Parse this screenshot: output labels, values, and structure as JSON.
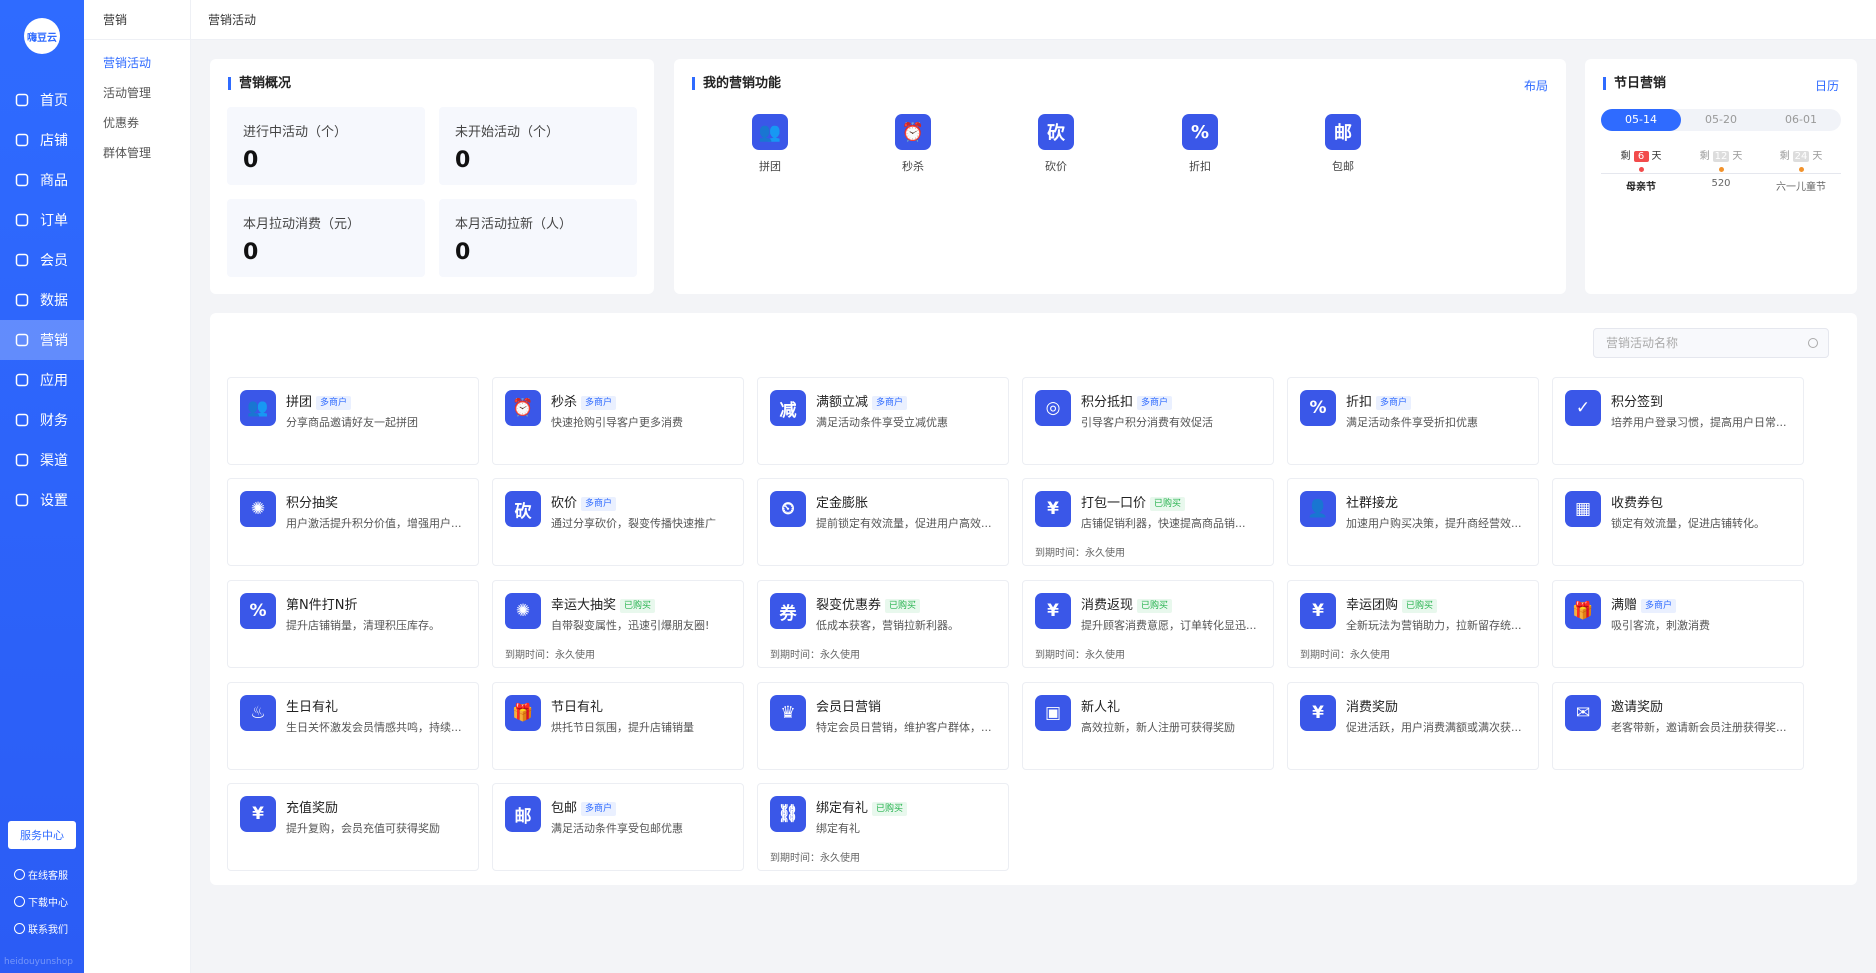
{
  "app": {
    "logo_text": "嗨豆云",
    "watermark": "heidouyunshop"
  },
  "nav": [
    {
      "label": "首页",
      "icon": "home-icon",
      "active": false
    },
    {
      "label": "店铺",
      "icon": "store-icon",
      "active": false
    },
    {
      "label": "商品",
      "icon": "goods-icon",
      "active": false
    },
    {
      "label": "订单",
      "icon": "order-icon",
      "active": false
    },
    {
      "label": "会员",
      "icon": "member-icon",
      "active": false
    },
    {
      "label": "数据",
      "icon": "chart-icon",
      "active": false
    },
    {
      "label": "营销",
      "icon": "tag-icon",
      "active": true
    },
    {
      "label": "应用",
      "icon": "app-icon",
      "active": false
    },
    {
      "label": "财务",
      "icon": "finance-icon",
      "active": false
    },
    {
      "label": "渠道",
      "icon": "channel-icon",
      "active": false
    },
    {
      "label": "设置",
      "icon": "gear-icon",
      "active": false
    }
  ],
  "bottom": {
    "service_center": "服务中心",
    "online_service": "在线客服",
    "download_center": "下载中心",
    "contact_us": "联系我们"
  },
  "subnav": {
    "title": "营销",
    "items": [
      {
        "label": "营销活动",
        "active": true
      },
      {
        "label": "活动管理",
        "active": false
      },
      {
        "label": "优惠券",
        "active": false
      },
      {
        "label": "群体管理",
        "active": false
      }
    ]
  },
  "breadcrumb": "营销活动",
  "overview": {
    "title": "营销概况",
    "stats": [
      {
        "label": "进行中活动（个）",
        "value": "0"
      },
      {
        "label": "未开始活动（个）",
        "value": "0"
      },
      {
        "label": "本月拉动消费（元）",
        "value": "0"
      },
      {
        "label": "本月活动拉新（人）",
        "value": "0"
      }
    ]
  },
  "my_functions": {
    "title": "我的营销功能",
    "layout_link": "布局",
    "items": [
      {
        "label": "拼团",
        "icon": "group-buy-icon",
        "glyph": "👥"
      },
      {
        "label": "秒杀",
        "icon": "alarm-clock-icon",
        "glyph": "⏰"
      },
      {
        "label": "砍价",
        "icon": "bargain-icon",
        "glyph": "砍"
      },
      {
        "label": "折扣",
        "icon": "discount-tag-icon",
        "glyph": "%"
      },
      {
        "label": "包邮",
        "icon": "free-shipping-icon",
        "glyph": "邮"
      }
    ]
  },
  "holiday": {
    "title": "节日营销",
    "calendar_link": "日历",
    "tabs": [
      "05-14",
      "05-20",
      "06-01"
    ],
    "active_tab": 0,
    "days": [
      {
        "prefix": "剩",
        "num": "6",
        "suffix": "天"
      },
      {
        "prefix": "剩",
        "num": "12",
        "suffix": "天"
      },
      {
        "prefix": "剩",
        "num": "24",
        "suffix": "天"
      }
    ],
    "holidays": [
      "母亲节",
      "520",
      "六一儿童节"
    ]
  },
  "search": {
    "placeholder": "营销活动名称"
  },
  "expiry_label": "到期时间：",
  "expiry_value": "永久使用",
  "activities": [
    {
      "name": "拼团",
      "tag": "多商户",
      "tag_type": "multi",
      "desc": "分享商品邀请好友一起拼团",
      "icon": "group-buy-icon",
      "glyph": "👥",
      "expiry": false
    },
    {
      "name": "秒杀",
      "tag": "多商户",
      "tag_type": "multi",
      "desc": "快速抢购引导客户更多消费",
      "icon": "alarm-clock-icon",
      "glyph": "⏰",
      "expiry": false
    },
    {
      "name": "满额立减",
      "tag": "多商户",
      "tag_type": "multi",
      "desc": "满足活动条件享受立减优惠",
      "icon": "reduce-icon",
      "glyph": "减",
      "expiry": false
    },
    {
      "name": "积分抵扣",
      "tag": "多商户",
      "tag_type": "multi",
      "desc": "引导客户积分消费有效促活",
      "icon": "coins-icon",
      "glyph": "◎",
      "expiry": false
    },
    {
      "name": "折扣",
      "tag": "多商户",
      "tag_type": "multi",
      "desc": "满足活动条件享受折扣优惠",
      "icon": "discount-tag-icon",
      "glyph": "%",
      "expiry": false
    },
    {
      "name": "积分签到",
      "tag": "",
      "tag_type": "",
      "desc": "培养用户登录习惯，提高用户日常...",
      "icon": "calendar-check-icon",
      "glyph": "✓",
      "expiry": false
    },
    {
      "name": "积分抽奖",
      "tag": "",
      "tag_type": "",
      "desc": "用户激活提升积分价值，增强用户...",
      "icon": "lottery-wheel-icon",
      "glyph": "✺",
      "expiry": false
    },
    {
      "name": "砍价",
      "tag": "多商户",
      "tag_type": "multi",
      "desc": "通过分享砍价，裂变传播快速推广",
      "icon": "bargain-icon",
      "glyph": "砍",
      "expiry": false
    },
    {
      "name": "定金膨胀",
      "tag": "",
      "tag_type": "",
      "desc": "提前锁定有效流量，促进用户高效...",
      "icon": "deposit-icon",
      "glyph": "⏲",
      "expiry": false
    },
    {
      "name": "打包一口价",
      "tag": "已购买",
      "tag_type": "bought",
      "desc": "店铺促销利器，快速提高商品销...",
      "icon": "package-price-icon",
      "glyph": "¥",
      "expiry": true
    },
    {
      "name": "社群接龙",
      "tag": "",
      "tag_type": "",
      "desc": "加速用户购买决策，提升商经营效...",
      "icon": "community-icon",
      "glyph": "👤",
      "expiry": false
    },
    {
      "name": "收费券包",
      "tag": "",
      "tag_type": "",
      "desc": "锁定有效流量，促进店铺转化。",
      "icon": "coupon-pack-icon",
      "glyph": "▦",
      "expiry": false
    },
    {
      "name": "第N件打N折",
      "tag": "",
      "tag_type": "",
      "desc": "提升店铺销量，清理积压库存。",
      "icon": "nth-discount-icon",
      "glyph": "%",
      "expiry": false
    },
    {
      "name": "幸运大抽奖",
      "tag": "已购买",
      "tag_type": "bought",
      "desc": "自带裂变属性，迅速引爆朋友圈!",
      "icon": "lucky-draw-icon",
      "glyph": "✺",
      "expiry": true
    },
    {
      "name": "裂变优惠券",
      "tag": "已购买",
      "tag_type": "bought",
      "desc": "低成本获客，营销拉新利器。",
      "icon": "fission-coupon-icon",
      "glyph": "券",
      "expiry": true
    },
    {
      "name": "消费返现",
      "tag": "已购买",
      "tag_type": "bought",
      "desc": "提升顾客消费意愿，订单转化显迅...",
      "icon": "cashback-icon",
      "glyph": "¥",
      "expiry": true
    },
    {
      "name": "幸运团购",
      "tag": "已购买",
      "tag_type": "bought",
      "desc": "全新玩法为营销助力，拉新留存统...",
      "icon": "lucky-group-icon",
      "glyph": "¥",
      "expiry": true
    },
    {
      "name": "满赠",
      "tag": "多商户",
      "tag_type": "multi",
      "desc": "吸引客流，刺激消费",
      "icon": "gift-icon",
      "glyph": "🎁",
      "expiry": false
    },
    {
      "name": "生日有礼",
      "tag": "",
      "tag_type": "",
      "desc": "生日关怀激发会员情感共鸣，持续...",
      "icon": "birthday-cake-icon",
      "glyph": "♨",
      "expiry": false
    },
    {
      "name": "节日有礼",
      "tag": "",
      "tag_type": "",
      "desc": "烘托节日氛围，提升店铺销量",
      "icon": "festival-gift-icon",
      "glyph": "🎁",
      "expiry": false
    },
    {
      "name": "会员日营销",
      "tag": "",
      "tag_type": "",
      "desc": "特定会员日营销，维护客户群体，...",
      "icon": "crown-icon",
      "glyph": "♛",
      "expiry": false
    },
    {
      "name": "新人礼",
      "tag": "",
      "tag_type": "",
      "desc": "高效拉新，新人注册可获得奖励",
      "icon": "new-user-gift-icon",
      "glyph": "▣",
      "expiry": false
    },
    {
      "name": "消费奖励",
      "tag": "",
      "tag_type": "",
      "desc": "促进活跃，用户消费满额或满次获...",
      "icon": "receipt-icon",
      "glyph": "¥",
      "expiry": false
    },
    {
      "name": "邀请奖励",
      "tag": "",
      "tag_type": "",
      "desc": "老客带新，邀请新会员注册获得奖...",
      "icon": "invite-envelope-icon",
      "glyph": "✉",
      "expiry": false
    },
    {
      "name": "充值奖励",
      "tag": "",
      "tag_type": "",
      "desc": "提升复购，会员充值可获得奖励",
      "icon": "recharge-icon",
      "glyph": "¥",
      "expiry": false
    },
    {
      "name": "包邮",
      "tag": "多商户",
      "tag_type": "multi",
      "desc": "满足活动条件享受包邮优惠",
      "icon": "free-shipping-icon",
      "glyph": "邮",
      "expiry": false
    },
    {
      "name": "绑定有礼",
      "tag": "已购买",
      "tag_type": "bought",
      "desc": "绑定有礼",
      "icon": "bind-gift-icon",
      "glyph": "⛓",
      "expiry": true
    }
  ]
}
